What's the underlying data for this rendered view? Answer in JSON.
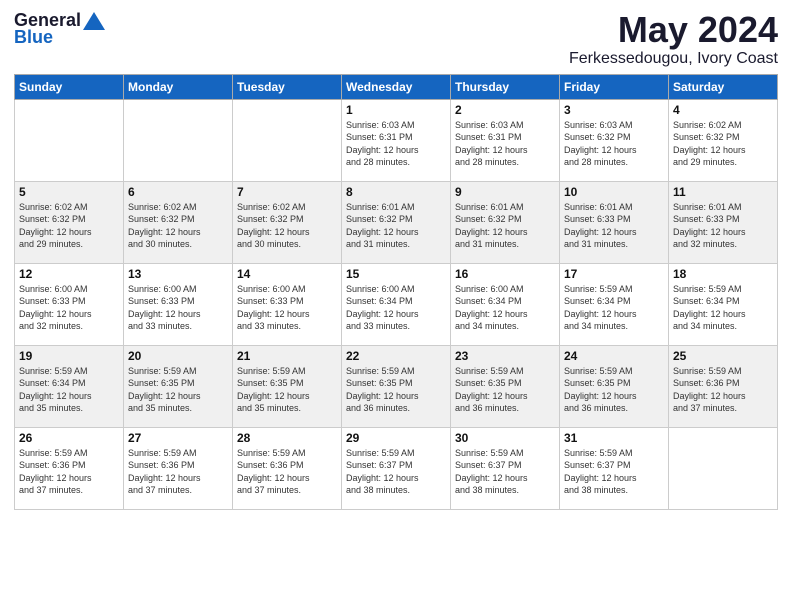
{
  "logo": {
    "general": "General",
    "blue": "Blue"
  },
  "title": "May 2024",
  "subtitle": "Ferkessedougou, Ivory Coast",
  "days_of_week": [
    "Sunday",
    "Monday",
    "Tuesday",
    "Wednesday",
    "Thursday",
    "Friday",
    "Saturday"
  ],
  "weeks": [
    [
      {
        "day": "",
        "info": ""
      },
      {
        "day": "",
        "info": ""
      },
      {
        "day": "",
        "info": ""
      },
      {
        "day": "1",
        "info": "Sunrise: 6:03 AM\nSunset: 6:31 PM\nDaylight: 12 hours\nand 28 minutes."
      },
      {
        "day": "2",
        "info": "Sunrise: 6:03 AM\nSunset: 6:31 PM\nDaylight: 12 hours\nand 28 minutes."
      },
      {
        "day": "3",
        "info": "Sunrise: 6:03 AM\nSunset: 6:32 PM\nDaylight: 12 hours\nand 28 minutes."
      },
      {
        "day": "4",
        "info": "Sunrise: 6:02 AM\nSunset: 6:32 PM\nDaylight: 12 hours\nand 29 minutes."
      }
    ],
    [
      {
        "day": "5",
        "info": "Sunrise: 6:02 AM\nSunset: 6:32 PM\nDaylight: 12 hours\nand 29 minutes."
      },
      {
        "day": "6",
        "info": "Sunrise: 6:02 AM\nSunset: 6:32 PM\nDaylight: 12 hours\nand 30 minutes."
      },
      {
        "day": "7",
        "info": "Sunrise: 6:02 AM\nSunset: 6:32 PM\nDaylight: 12 hours\nand 30 minutes."
      },
      {
        "day": "8",
        "info": "Sunrise: 6:01 AM\nSunset: 6:32 PM\nDaylight: 12 hours\nand 31 minutes."
      },
      {
        "day": "9",
        "info": "Sunrise: 6:01 AM\nSunset: 6:32 PM\nDaylight: 12 hours\nand 31 minutes."
      },
      {
        "day": "10",
        "info": "Sunrise: 6:01 AM\nSunset: 6:33 PM\nDaylight: 12 hours\nand 31 minutes."
      },
      {
        "day": "11",
        "info": "Sunrise: 6:01 AM\nSunset: 6:33 PM\nDaylight: 12 hours\nand 32 minutes."
      }
    ],
    [
      {
        "day": "12",
        "info": "Sunrise: 6:00 AM\nSunset: 6:33 PM\nDaylight: 12 hours\nand 32 minutes."
      },
      {
        "day": "13",
        "info": "Sunrise: 6:00 AM\nSunset: 6:33 PM\nDaylight: 12 hours\nand 33 minutes."
      },
      {
        "day": "14",
        "info": "Sunrise: 6:00 AM\nSunset: 6:33 PM\nDaylight: 12 hours\nand 33 minutes."
      },
      {
        "day": "15",
        "info": "Sunrise: 6:00 AM\nSunset: 6:34 PM\nDaylight: 12 hours\nand 33 minutes."
      },
      {
        "day": "16",
        "info": "Sunrise: 6:00 AM\nSunset: 6:34 PM\nDaylight: 12 hours\nand 34 minutes."
      },
      {
        "day": "17",
        "info": "Sunrise: 5:59 AM\nSunset: 6:34 PM\nDaylight: 12 hours\nand 34 minutes."
      },
      {
        "day": "18",
        "info": "Sunrise: 5:59 AM\nSunset: 6:34 PM\nDaylight: 12 hours\nand 34 minutes."
      }
    ],
    [
      {
        "day": "19",
        "info": "Sunrise: 5:59 AM\nSunset: 6:34 PM\nDaylight: 12 hours\nand 35 minutes."
      },
      {
        "day": "20",
        "info": "Sunrise: 5:59 AM\nSunset: 6:35 PM\nDaylight: 12 hours\nand 35 minutes."
      },
      {
        "day": "21",
        "info": "Sunrise: 5:59 AM\nSunset: 6:35 PM\nDaylight: 12 hours\nand 35 minutes."
      },
      {
        "day": "22",
        "info": "Sunrise: 5:59 AM\nSunset: 6:35 PM\nDaylight: 12 hours\nand 36 minutes."
      },
      {
        "day": "23",
        "info": "Sunrise: 5:59 AM\nSunset: 6:35 PM\nDaylight: 12 hours\nand 36 minutes."
      },
      {
        "day": "24",
        "info": "Sunrise: 5:59 AM\nSunset: 6:35 PM\nDaylight: 12 hours\nand 36 minutes."
      },
      {
        "day": "25",
        "info": "Sunrise: 5:59 AM\nSunset: 6:36 PM\nDaylight: 12 hours\nand 37 minutes."
      }
    ],
    [
      {
        "day": "26",
        "info": "Sunrise: 5:59 AM\nSunset: 6:36 PM\nDaylight: 12 hours\nand 37 minutes."
      },
      {
        "day": "27",
        "info": "Sunrise: 5:59 AM\nSunset: 6:36 PM\nDaylight: 12 hours\nand 37 minutes."
      },
      {
        "day": "28",
        "info": "Sunrise: 5:59 AM\nSunset: 6:36 PM\nDaylight: 12 hours\nand 37 minutes."
      },
      {
        "day": "29",
        "info": "Sunrise: 5:59 AM\nSunset: 6:37 PM\nDaylight: 12 hours\nand 38 minutes."
      },
      {
        "day": "30",
        "info": "Sunrise: 5:59 AM\nSunset: 6:37 PM\nDaylight: 12 hours\nand 38 minutes."
      },
      {
        "day": "31",
        "info": "Sunrise: 5:59 AM\nSunset: 6:37 PM\nDaylight: 12 hours\nand 38 minutes."
      },
      {
        "day": "",
        "info": ""
      }
    ]
  ]
}
